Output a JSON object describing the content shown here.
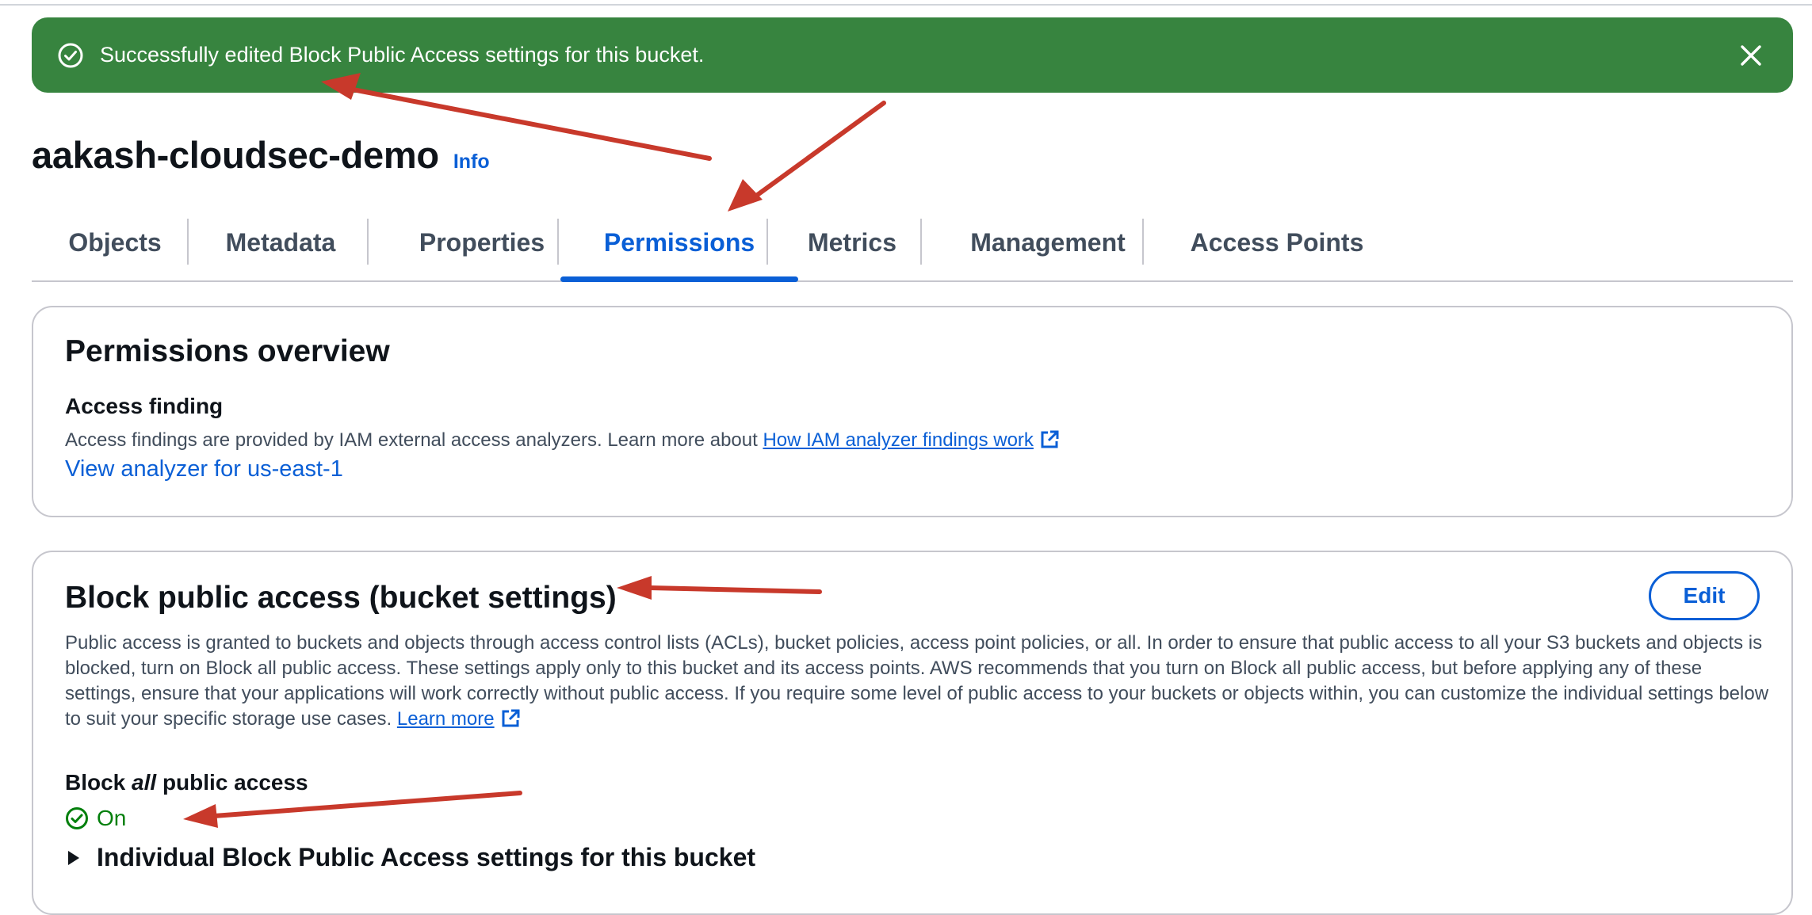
{
  "flash": {
    "message": "Successfully edited Block Public Access settings for this bucket.",
    "icon": "check-circle-icon",
    "close_icon": "close-icon",
    "color": "#37843f"
  },
  "header": {
    "bucket_name": "aakash-cloudsec-demo",
    "info_label": "Info"
  },
  "tabs": [
    {
      "label": "Objects",
      "active": false
    },
    {
      "label": "Metadata",
      "active": false
    },
    {
      "label": "Properties",
      "active": false
    },
    {
      "label": "Permissions",
      "active": true
    },
    {
      "label": "Metrics",
      "active": false
    },
    {
      "label": "Management",
      "active": false
    },
    {
      "label": "Access Points",
      "active": false
    }
  ],
  "permissions_overview": {
    "title": "Permissions overview",
    "access_finding_label": "Access finding",
    "description": "Access findings are provided by IAM external access analyzers. Learn more about",
    "link_text": "How IAM analyzer findings work",
    "analyzer_link": "View analyzer for us-east-1"
  },
  "block_public_access": {
    "title": "Block public access (bucket settings)",
    "edit_label": "Edit",
    "description": "Public access is granted to buckets and objects through access control lists (ACLs), bucket policies, access point policies, or all. In order to ensure that public access to all your S3 buckets and objects is blocked, turn on Block all public access. These settings apply only to this bucket and its access points. AWS recommends that you turn on Block all public access, but before applying any of these settings, ensure that your applications will work correctly without public access. If you require some level of public access to your buckets or objects within, you can customize the individual settings below to suit your specific storage use cases.",
    "learn_more": "Learn more",
    "block_all_prefix": "Block",
    "block_all_emph": "all",
    "block_all_suffix": "public access",
    "status": "On",
    "expander_label": "Individual Block Public Access settings for this bucket"
  },
  "colors": {
    "accent": "#0a5fd6",
    "success": "#037f0c",
    "annotation_arrow": "#c8392b"
  }
}
